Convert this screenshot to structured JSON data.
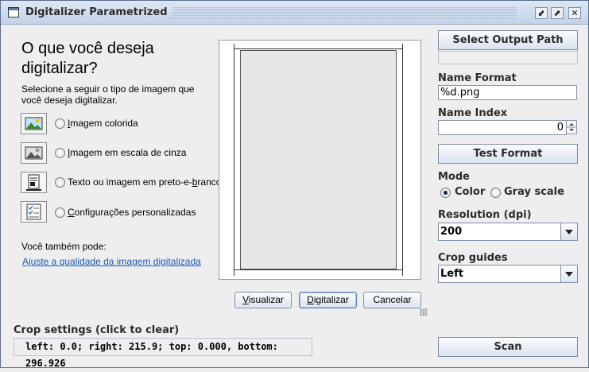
{
  "window": {
    "title": "Digitalizer Parametrized",
    "buttons": {
      "minimize": "⬋",
      "maximize": "⬈",
      "close": "✕"
    }
  },
  "scan_panel": {
    "heading": "O que você deseja digitalizar?",
    "instruction": "Selecione a seguir o tipo de imagem que você deseja digitalizar.",
    "options": [
      {
        "prefix": "",
        "accel": "I",
        "rest": "magem colorida",
        "icon": "color-picture-icon",
        "selected": false
      },
      {
        "prefix": "",
        "accel": "I",
        "rest": "magem em escala de cinza",
        "icon": "grayscale-picture-icon",
        "selected": false
      },
      {
        "prefix": "Texto ou imagem em preto-e-",
        "accel": "b",
        "rest": "ranco",
        "icon": "text-document-icon",
        "selected": false
      },
      {
        "prefix": "",
        "accel": "C",
        "rest": "onfigurações personalizadas",
        "icon": "custom-settings-icon",
        "selected": false
      }
    ],
    "also_label": "Você também pode:",
    "quality_link": "Ajuste a qualidade da imagem digitalizada",
    "buttons": {
      "preview": {
        "accel": "V",
        "rest": "isualizar"
      },
      "scan": {
        "accel": "D",
        "rest": "igitalizar"
      },
      "cancel": {
        "accel": "",
        "rest": "Cancelar"
      }
    }
  },
  "settings": {
    "select_output_label": "Select Output Path",
    "output_path_value": "",
    "name_format_label": "Name Format",
    "name_format_value": "%d.png",
    "name_index_label": "Name Index",
    "name_index_value": "0",
    "test_format_label": "Test Format",
    "mode_label": "Mode",
    "mode_options": [
      "Color",
      "Gray scale"
    ],
    "mode_selected": "Color",
    "resolution_label": "Resolution (dpi)",
    "resolution_value": "200",
    "crop_guides_label": "Crop guides",
    "crop_guides_value": "Left"
  },
  "crop": {
    "label": "Crop settings (click to clear)",
    "value": "left: 0.0; right: 215.9; top: 0.000, bottom: 296.926"
  },
  "scan_button_label": "Scan"
}
